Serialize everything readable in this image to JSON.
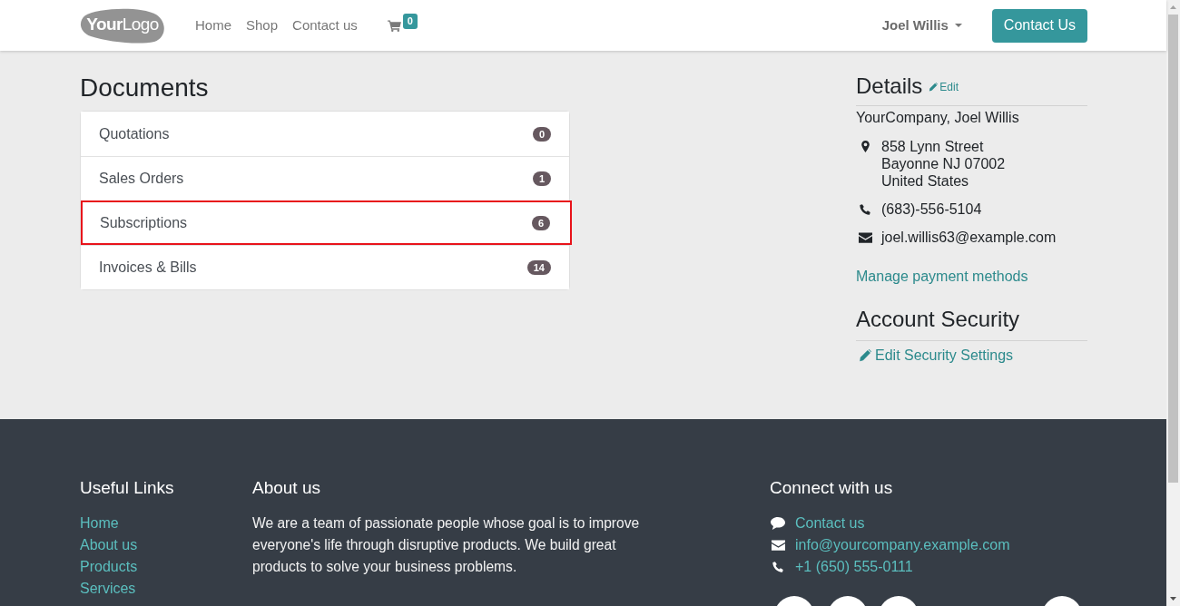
{
  "header": {
    "logo": "**Your**Logo",
    "nav": [
      {
        "label": "Home"
      },
      {
        "label": "Shop"
      },
      {
        "label": "Contact us"
      }
    ],
    "cart": {
      "count": "0"
    },
    "user": {
      "name": "Joel Willis"
    },
    "cta": {
      "label": "Contact Us"
    }
  },
  "documents": {
    "title": "Documents",
    "items": [
      {
        "label": "Quotations",
        "count": "0",
        "highlighted": false
      },
      {
        "label": "Sales Orders",
        "count": "1",
        "highlighted": false
      },
      {
        "label": "Subscriptions",
        "count": "6",
        "highlighted": true
      },
      {
        "label": "Invoices & Bills",
        "count": "14",
        "highlighted": false
      }
    ]
  },
  "details": {
    "title": "Details",
    "edit_link": "Edit",
    "name": "YourCompany, Joel Willis",
    "contacts": [
      {
        "kind": "address",
        "lines": [
          "858 Lynn Street",
          "Bayonne NJ 07002",
          "United States"
        ]
      },
      {
        "kind": "phone",
        "lines": [
          "(683)-556-5104"
        ]
      },
      {
        "kind": "email",
        "lines": [
          "joel.willis63@example.com"
        ]
      }
    ],
    "payment_link": "Manage payment methods"
  },
  "account_security": {
    "title": "Account Security",
    "edit_link": "Edit Security Settings"
  },
  "footer": {
    "useful_links": {
      "title": "Useful Links",
      "links": [
        "Home",
        "About us",
        "Products",
        "Services"
      ]
    },
    "about": {
      "title": "About us",
      "text": "We are a team of passionate people whose goal is to improve everyone's life through disruptive products. We build great products to solve your business problems."
    },
    "connect": {
      "title": "Connect with us",
      "items": [
        {
          "kind": "chat",
          "label": "Contact us"
        },
        {
          "kind": "email",
          "label": "info@yourcompany.example.com"
        },
        {
          "kind": "phone",
          "label": "+1 (650) 555-0111"
        }
      ]
    }
  }
}
